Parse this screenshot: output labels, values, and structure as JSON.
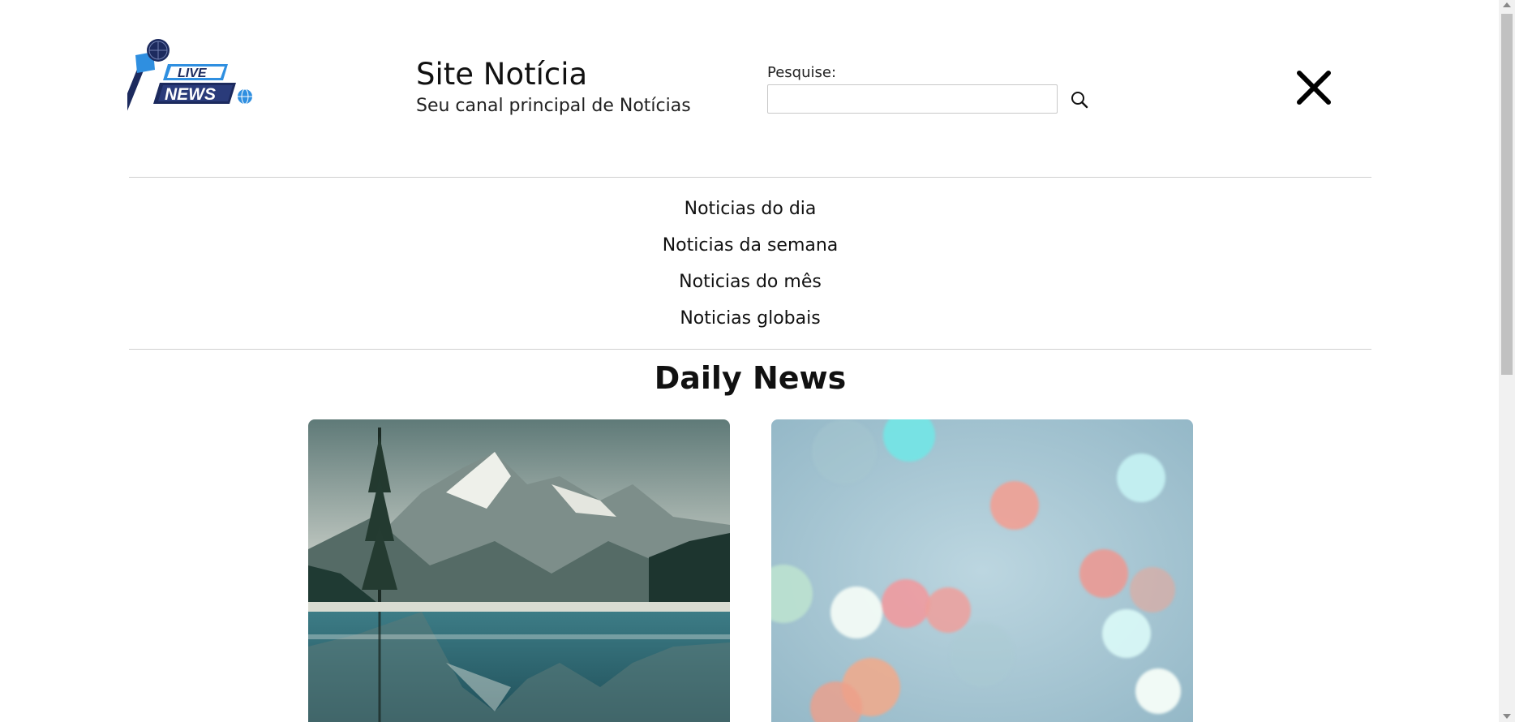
{
  "header": {
    "logo": {
      "top_text": "LIVE",
      "bottom_text": "NEWS",
      "icon": "microphone-globe-logo"
    },
    "title": "Site Notícia",
    "subtitle": "Seu canal principal de Notícias",
    "search": {
      "label": "Pesquise:",
      "value": "",
      "placeholder": "",
      "icon": "search-icon"
    },
    "close_icon": "close-icon"
  },
  "nav": {
    "items": [
      {
        "label": "Noticias do dia"
      },
      {
        "label": "Noticias da semana"
      },
      {
        "label": "Noticias do mês"
      },
      {
        "label": "Noticias globais"
      }
    ]
  },
  "main": {
    "section_title": "Daily News",
    "cards": [
      {
        "image": "mountain-lake-image"
      },
      {
        "image": "bokeh-lights-image"
      }
    ]
  },
  "colors": {
    "logo_dark": "#1c2a5e",
    "logo_blue": "#2f8fe0",
    "divider": "#cfcfcf",
    "text": "#111111"
  }
}
